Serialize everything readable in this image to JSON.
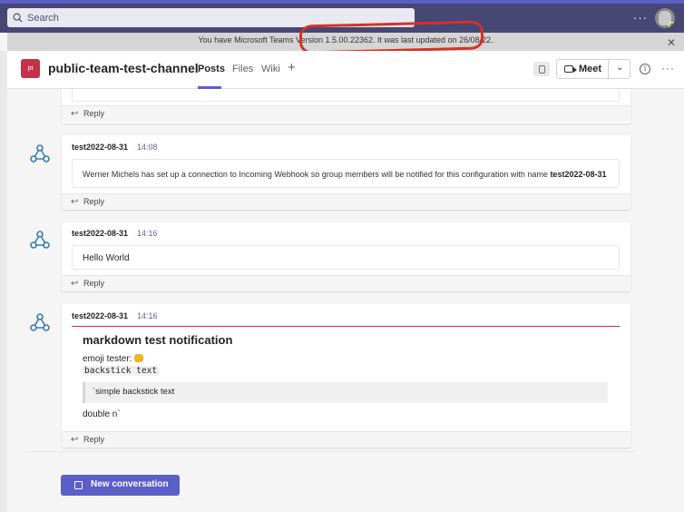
{
  "search": {
    "placeholder": "Search"
  },
  "top": {
    "more": "···"
  },
  "banner": {
    "text": "You have Microsoft Teams Version 1.5.00.22362. It was last updated on 26/08/22."
  },
  "channel": {
    "avatar_text": "pt",
    "title": "public-team-test-channel",
    "tabs": [
      "Posts",
      "Files",
      "Wiki"
    ],
    "add_tab": "+",
    "meet_label": "Meet",
    "info": "i",
    "more": "···"
  },
  "messages": [
    {
      "reply_label": "Reply"
    },
    {
      "sender": "test2022-08-31",
      "time": "14:08",
      "body_prefix": "Werner Michels has set up a connection to Incoming Webhook so group members will be notified for this configuration with name ",
      "body_bold": "test2022-08-31",
      "reply_label": "Reply"
    },
    {
      "sender": "test2022-08-31",
      "time": "14:16",
      "body": "Hello World",
      "reply_label": "Reply"
    },
    {
      "sender": "test2022-08-31",
      "time": "14:16",
      "card_title": "markdown test notification",
      "emoji_label": "emoji tester:",
      "code_text": "backstick text",
      "quote_text": "`simple backstick text",
      "double_text": "double n`",
      "reply_label": "Reply"
    }
  ],
  "composer": {
    "new_conversation": "New conversation"
  },
  "colors": {
    "brand": "#5b5fc7",
    "team_avatar": "#c4314b",
    "annotation": "#d63223"
  }
}
